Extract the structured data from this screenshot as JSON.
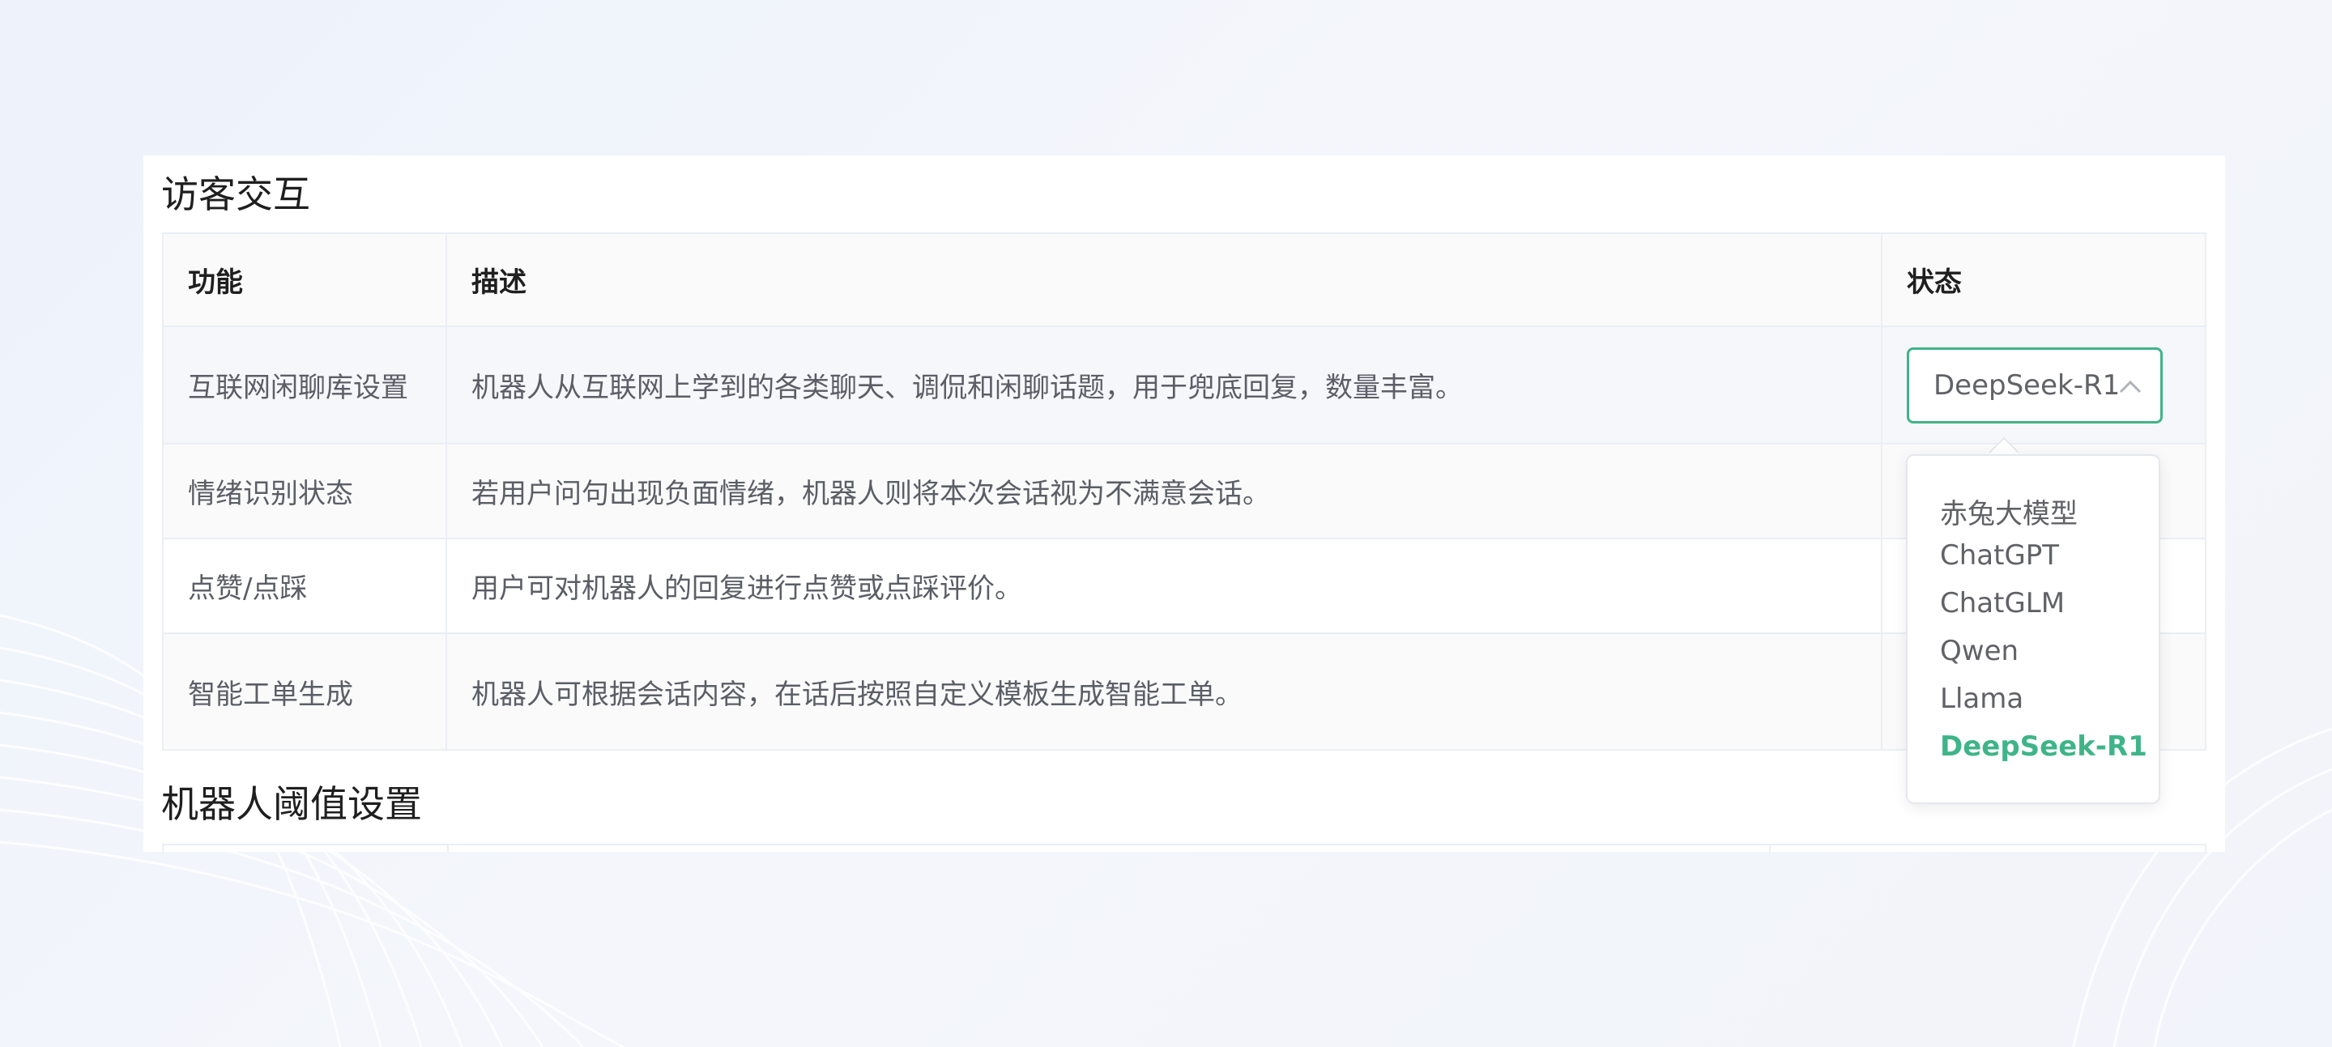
{
  "section_visitor": {
    "title": "访客交互"
  },
  "table": {
    "headers": {
      "feature": "功能",
      "description": "描述",
      "status": "状态"
    },
    "rows": [
      {
        "feature": "互联网闲聊库设置",
        "description": "机器人从互联网上学到的各类聊天、调侃和闲聊话题，用于兜底回复，数量丰富。"
      },
      {
        "feature": "情绪识别状态",
        "description": "若用户问句出现负面情绪，机器人则将本次会话视为不满意会话。"
      },
      {
        "feature": "点赞/点踩",
        "description": "用户可对机器人的回复进行点赞或点踩评价。"
      },
      {
        "feature": "智能工单生成",
        "description": "机器人可根据会话内容，在话后按照自定义模板生成智能工单。"
      }
    ]
  },
  "model_select": {
    "value": "DeepSeek-R1",
    "options": [
      "赤兔大模型",
      "ChatGPT",
      "ChatGLM",
      "Qwen",
      "Llama",
      "DeepSeek-R1"
    ],
    "selected_option": "DeepSeek-R1"
  },
  "section_threshold": {
    "title": "机器人阈值设置"
  },
  "colors": {
    "accent": "#3fb489",
    "border": "#ebeef5",
    "background": "#f1f4fa"
  }
}
